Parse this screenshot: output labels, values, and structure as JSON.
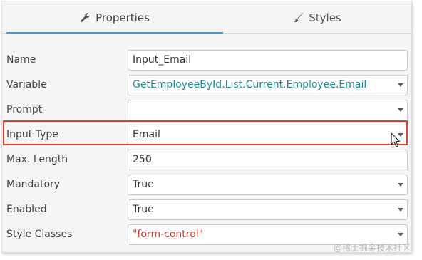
{
  "tabs": [
    {
      "label": "Properties",
      "icon": "wrench-icon",
      "active": true
    },
    {
      "label": "Styles",
      "icon": "brush-icon",
      "active": false
    }
  ],
  "properties": [
    {
      "label": "Name",
      "value": "Input_Email",
      "dropdown": false
    },
    {
      "label": "Variable",
      "value": "GetEmployeeById.List.Current.Employee.Email",
      "dropdown": true
    },
    {
      "label": "Prompt",
      "value": "",
      "dropdown": true
    },
    {
      "label": "Input Type",
      "value": "Email",
      "dropdown": true
    },
    {
      "label": "Max. Length",
      "value": "250",
      "dropdown": false
    },
    {
      "label": "Mandatory",
      "value": "True",
      "dropdown": true
    },
    {
      "label": "Enabled",
      "value": "True",
      "dropdown": true
    },
    {
      "label": "Style Classes",
      "value": "\"form-control\"",
      "dropdown": true
    }
  ],
  "colors": {
    "accent": "#3f9ad6",
    "highlight": "#d9452b",
    "expression": "#1a8a9c",
    "string_literal": "#c0392b"
  },
  "watermark": "@稀土掘金技术社区"
}
